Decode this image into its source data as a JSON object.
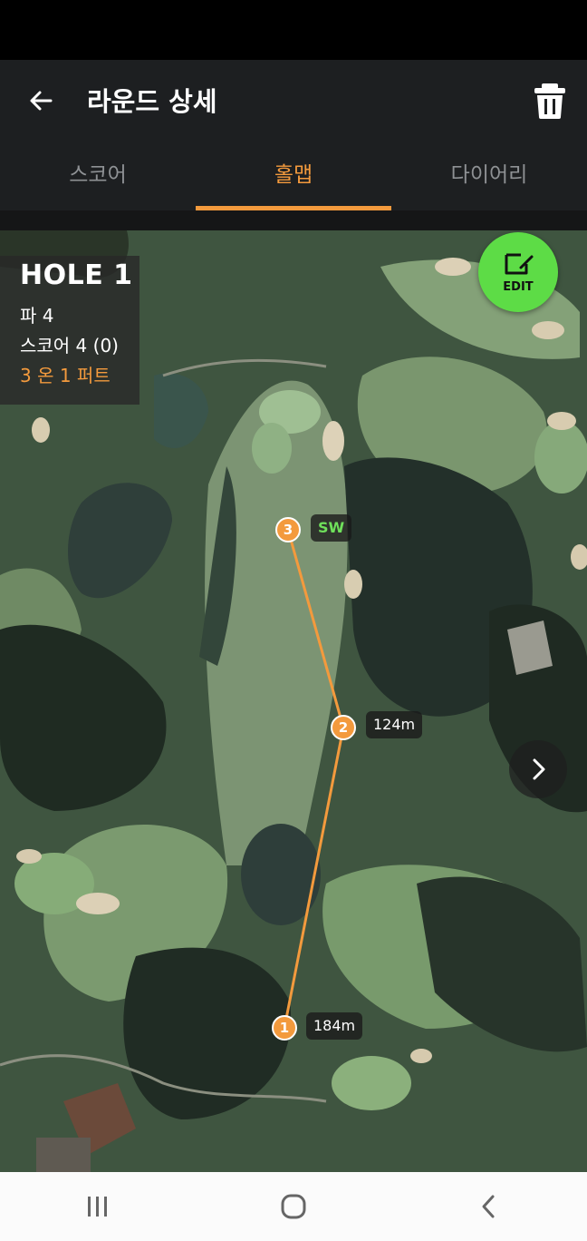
{
  "app_bar": {
    "title": "라운드 상세",
    "back_icon": "arrow-left-icon",
    "delete_icon": "trash-icon"
  },
  "tabs": [
    {
      "label": "스코어",
      "active": false
    },
    {
      "label": "홀맵",
      "active": true
    },
    {
      "label": "다이어리",
      "active": false
    }
  ],
  "hole_info": {
    "title": "HOLE 1",
    "par": "파 4",
    "score": "스코어 4 (0)",
    "putt_summary": "3 온 1 퍼트"
  },
  "edit_button": {
    "label": "EDIT",
    "icon": "edit-square-icon"
  },
  "shots": [
    {
      "number": "1",
      "label": "184m"
    },
    {
      "number": "2",
      "label": "124m"
    },
    {
      "number": "3",
      "label": "SW"
    }
  ],
  "next_hole_icon": "chevron-right-icon",
  "nav": {
    "recents_icon": "recents-icon",
    "home_icon": "home-icon",
    "back_icon": "back-icon"
  },
  "colors": {
    "accent": "#f39a3d",
    "edit_green": "#5ddc46",
    "club_label": "#6fe05b",
    "app_bar": "#1d1f21"
  }
}
